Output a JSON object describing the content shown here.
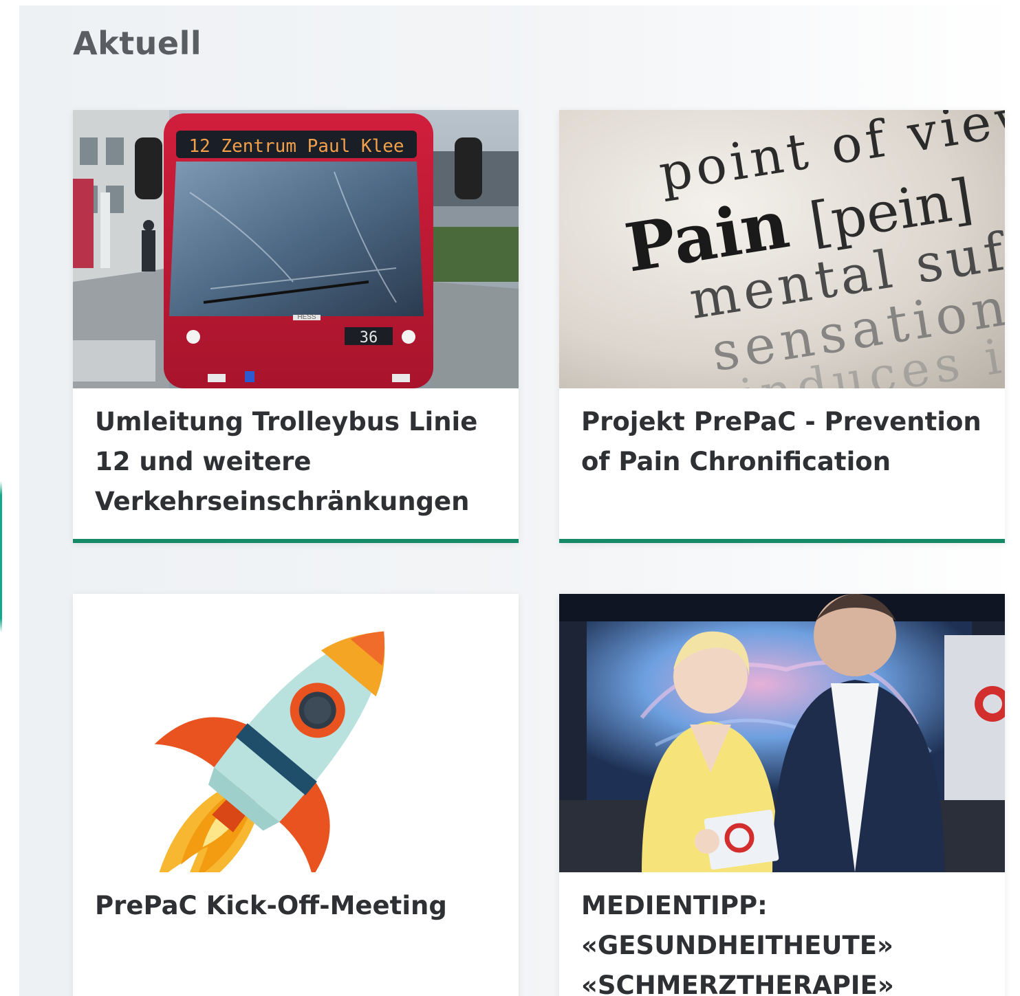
{
  "section": {
    "title": "Aktuell"
  },
  "cards": [
    {
      "title": "Umleitung Trolleybus Linie 12 und weitere Verkehrseinschränkungen",
      "image": {
        "icon": "trolleybus-photo",
        "destination_sign": "12 Zentrum Paul Klee",
        "fleet_number": "36",
        "brand": "HESS"
      },
      "accent": "#168a66"
    },
    {
      "title": "Projekt PrePaC - Prevention of Pain Chronification",
      "image": {
        "icon": "dictionary-pain-photo",
        "line1": "point of view",
        "line2_bold": "Pain",
        "line2_rest": "[pein]",
        "line3": "mental suf",
        "line4": "sensation",
        "line5": "induces in"
      },
      "accent": "#168a66"
    },
    {
      "title": "PrePaC Kick-Off-Meeting",
      "image": {
        "icon": "rocket-illustration"
      }
    },
    {
      "title": "MEDIENTIPP: «GESUNDHEITHEUTE» «SCHMERZTHERAPIE»",
      "image": {
        "icon": "tv-studio-photo"
      }
    }
  ]
}
